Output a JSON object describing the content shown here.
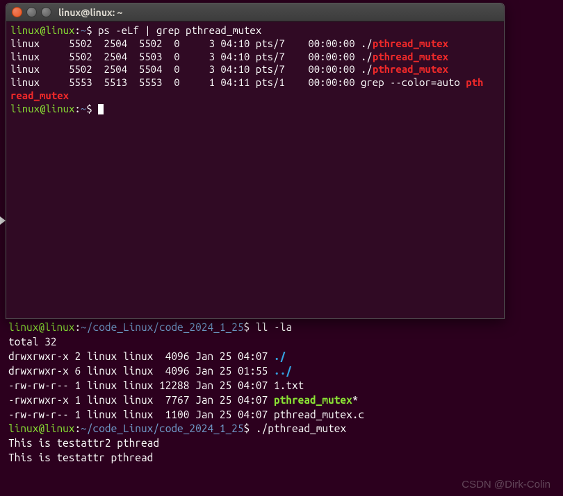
{
  "window": {
    "title": "linux@linux: ~"
  },
  "fg_terminal": {
    "prompt_user": "linux@linux",
    "prompt_path": "~",
    "prompt_sep": ":",
    "prompt_end": "$ ",
    "command": "ps -eLf | grep pthread_mutex",
    "rows": [
      {
        "user": "linux",
        "pid": "5502",
        "ppid": "2504",
        "lwp": "5502",
        "c": "0",
        "nlwp": "3",
        "stime": "04:10",
        "tty": "pts/7",
        "time": "00:00:00",
        "cmd_prefix": "./",
        "cmd_match": "pthread_mutex",
        "cmd_suffix": ""
      },
      {
        "user": "linux",
        "pid": "5502",
        "ppid": "2504",
        "lwp": "5503",
        "c": "0",
        "nlwp": "3",
        "stime": "04:10",
        "tty": "pts/7",
        "time": "00:00:00",
        "cmd_prefix": "./",
        "cmd_match": "pthread_mutex",
        "cmd_suffix": ""
      },
      {
        "user": "linux",
        "pid": "5502",
        "ppid": "2504",
        "lwp": "5504",
        "c": "0",
        "nlwp": "3",
        "stime": "04:10",
        "tty": "pts/7",
        "time": "00:00:00",
        "cmd_prefix": "./",
        "cmd_match": "pthread_mutex",
        "cmd_suffix": ""
      },
      {
        "user": "linux",
        "pid": "5553",
        "ppid": "5513",
        "lwp": "5553",
        "c": "0",
        "nlwp": "1",
        "stime": "04:11",
        "tty": "pts/1",
        "time": "00:00:00",
        "cmd_prefix": "grep --color=auto ",
        "cmd_match": "pthread_mutex",
        "cmd_suffix": "",
        "wrap": true
      }
    ]
  },
  "bg_terminal": {
    "prompt_user": "linux@linux",
    "prompt_path": "~/code_Linux/code_2024_1_25",
    "prompt_sep": ":",
    "prompt_end": "$ ",
    "cmd1": "ll -la",
    "total_line": "total 32",
    "files": [
      {
        "perms": "drwxrwxr-x",
        "links": "2",
        "owner": "linux",
        "group": "linux",
        "size": " 4096",
        "date": "Jan 25 04:07",
        "name": "./",
        "color": "blue-bold"
      },
      {
        "perms": "drwxrwxr-x",
        "links": "6",
        "owner": "linux",
        "group": "linux",
        "size": " 4096",
        "date": "Jan 25 01:55",
        "name": "../",
        "color": "blue-bold"
      },
      {
        "perms": "-rw-rw-r--",
        "links": "1",
        "owner": "linux",
        "group": "linux",
        "size": "12288",
        "date": "Jan 25 04:07",
        "name": "1.txt",
        "color": "white"
      },
      {
        "perms": "-rwxrwxr-x",
        "links": "1",
        "owner": "linux",
        "group": "linux",
        "size": " 7767",
        "date": "Jan 25 04:07",
        "name": "pthread_mutex",
        "suffix": "*",
        "color": "green-bold"
      },
      {
        "perms": "-rw-rw-r--",
        "links": "1",
        "owner": "linux",
        "group": "linux",
        "size": " 1100",
        "date": "Jan 25 04:07",
        "name": "pthread_mutex.c",
        "color": "white"
      }
    ],
    "cmd2": "./pthread_mutex",
    "output": [
      "This is testattr2 pthread",
      "This is testattr pthread"
    ]
  },
  "watermark": "CSDN @Dirk-Colin"
}
